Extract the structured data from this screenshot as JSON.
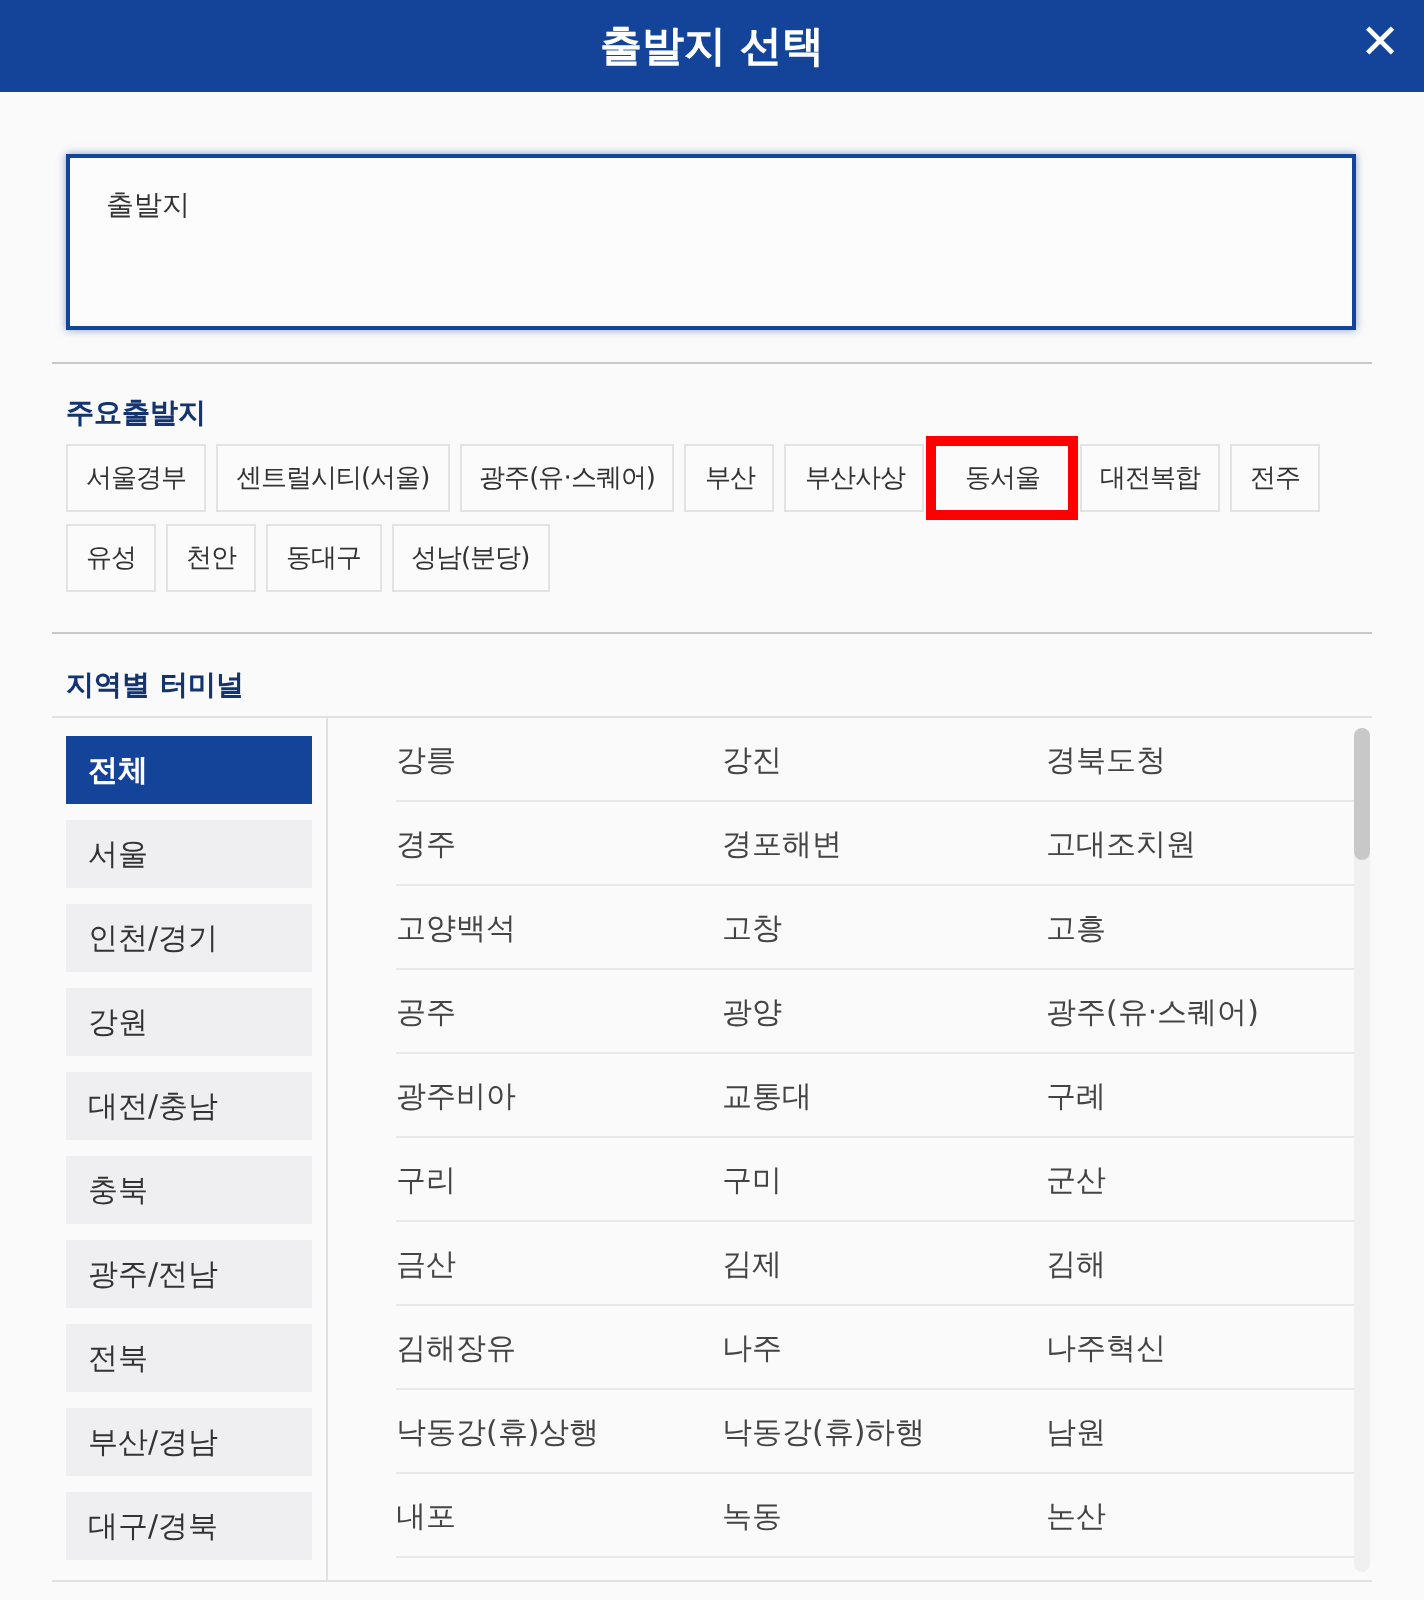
{
  "header": {
    "title": "출발지 선택",
    "close": "✕"
  },
  "origin_field": {
    "placeholder": "출발지"
  },
  "major_origins": {
    "heading": "주요출발지",
    "chips": [
      {
        "label": "서울경부",
        "highlighted": false
      },
      {
        "label": "센트럴시티(서울)",
        "highlighted": false
      },
      {
        "label": "광주(유·스퀘어)",
        "highlighted": false
      },
      {
        "label": "부산",
        "highlighted": false
      },
      {
        "label": "부산사상",
        "highlighted": false
      },
      {
        "label": "동서울",
        "highlighted": true
      },
      {
        "label": "대전복합",
        "highlighted": false
      },
      {
        "label": "전주",
        "highlighted": false
      },
      {
        "label": "유성",
        "highlighted": false
      },
      {
        "label": "천안",
        "highlighted": false
      },
      {
        "label": "동대구",
        "highlighted": false
      },
      {
        "label": "성남(분당)",
        "highlighted": false
      }
    ]
  },
  "regional": {
    "heading": "지역별 터미널",
    "regions": [
      {
        "label": "전체",
        "selected": true
      },
      {
        "label": "서울",
        "selected": false
      },
      {
        "label": "인천/경기",
        "selected": false
      },
      {
        "label": "강원",
        "selected": false
      },
      {
        "label": "대전/충남",
        "selected": false
      },
      {
        "label": "충북",
        "selected": false
      },
      {
        "label": "광주/전남",
        "selected": false
      },
      {
        "label": "전북",
        "selected": false
      },
      {
        "label": "부산/경남",
        "selected": false
      },
      {
        "label": "대구/경북",
        "selected": false
      }
    ],
    "terminals": [
      "강릉",
      "강진",
      "경북도청",
      "경주",
      "경포해변",
      "고대조치원",
      "고양백석",
      "고창",
      "고흥",
      "공주",
      "광양",
      "광주(유·스퀘어)",
      "광주비아",
      "교통대",
      "구례",
      "구리",
      "구미",
      "군산",
      "금산",
      "김제",
      "김해",
      "김해장유",
      "나주",
      "나주혁신",
      "낙동강(휴)상행",
      "낙동강(휴)하행",
      "남원",
      "내포",
      "녹동",
      "논산"
    ]
  }
}
